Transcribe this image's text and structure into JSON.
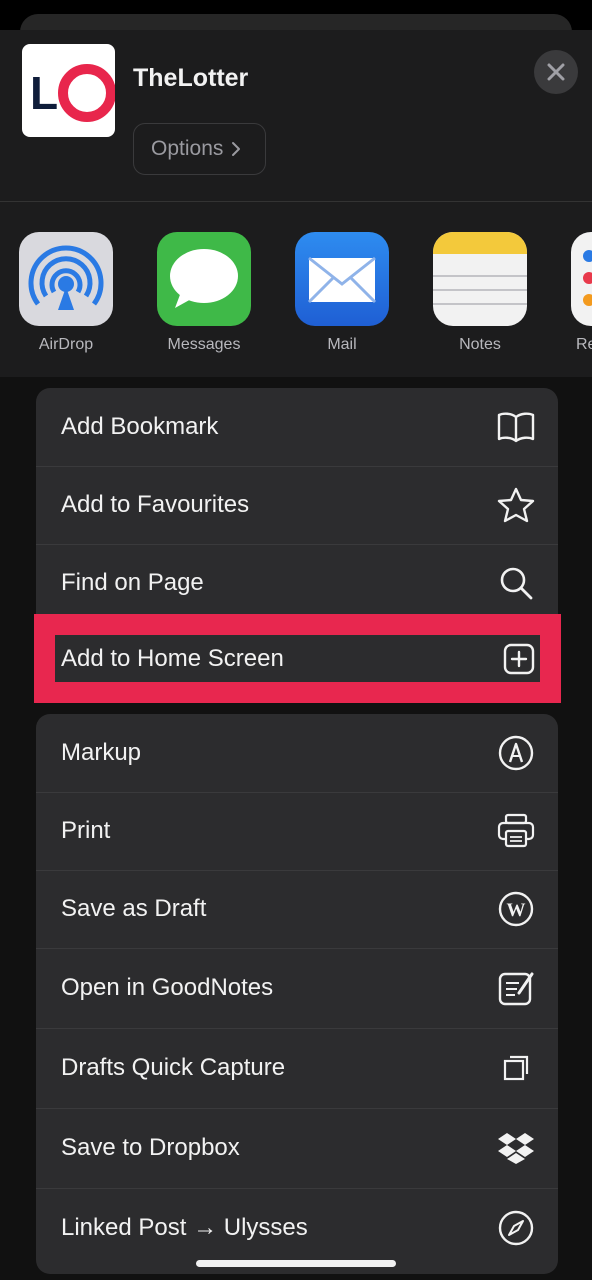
{
  "header": {
    "app_title": "TheLotter",
    "options_label": "Options",
    "logo_text": "LO",
    "brand_color": "#e8264c"
  },
  "share_apps": [
    {
      "label": "AirDrop",
      "icon": "airdrop-icon"
    },
    {
      "label": "Messages",
      "icon": "messages-icon"
    },
    {
      "label": "Mail",
      "icon": "mail-icon"
    },
    {
      "label": "Notes",
      "icon": "notes-icon"
    },
    {
      "label": "Re",
      "icon": "reminders-icon"
    }
  ],
  "actions_group1": [
    {
      "label": "Add Bookmark",
      "icon": "book-icon"
    },
    {
      "label": "Add to Favourites",
      "icon": "star-icon"
    },
    {
      "label": "Find on Page",
      "icon": "search-icon"
    },
    {
      "label": "Add to Home Screen",
      "icon": "plus-square-icon"
    }
  ],
  "actions_group2": [
    {
      "label": "Markup",
      "icon": "markup-icon"
    },
    {
      "label": "Print",
      "icon": "printer-icon"
    },
    {
      "label": "Save as Draft",
      "icon": "wordpress-icon"
    },
    {
      "label": "Open in GoodNotes",
      "icon": "goodnotes-icon"
    },
    {
      "label": "Drafts Quick Capture",
      "icon": "drafts-icon"
    },
    {
      "label": "Save to Dropbox",
      "icon": "dropbox-icon"
    },
    {
      "label": "Linked Post → Ulysses",
      "icon": "compass-icon"
    }
  ],
  "highlight_color": "#e8274f"
}
